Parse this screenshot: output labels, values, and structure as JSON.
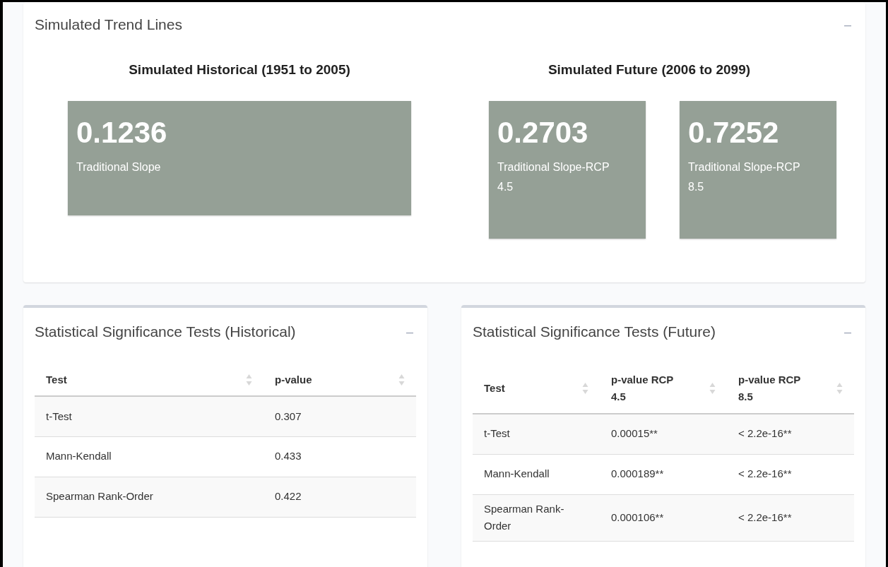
{
  "trend_card": {
    "title": "Simulated Trend Lines",
    "collapse_icon": "–",
    "groups": [
      {
        "heading": "Simulated Historical (1951 to 2005)",
        "boxes": [
          {
            "value": "0.1236",
            "label": "Traditional Slope"
          }
        ]
      },
      {
        "heading": "Simulated Future (2006 to 2099)",
        "boxes": [
          {
            "value": "0.2703",
            "label": "Traditional Slope-RCP 4.5"
          },
          {
            "value": "0.7252",
            "label": "Traditional Slope-RCP 8.5"
          }
        ]
      }
    ]
  },
  "tables": [
    {
      "title": "Statistical Significance Tests (Historical)",
      "collapse_icon": "–",
      "columns": [
        "Test",
        "p-value"
      ],
      "rows": [
        [
          "t-Test",
          "0.307"
        ],
        [
          "Mann-Kendall",
          "0.433"
        ],
        [
          "Spearman Rank-Order",
          "0.422"
        ]
      ]
    },
    {
      "title": "Statistical Significance Tests (Future)",
      "collapse_icon": "–",
      "columns": [
        "Test",
        "p-value RCP 4.5",
        "p-value RCP 8.5"
      ],
      "rows": [
        [
          "t-Test",
          "0.00015**",
          "< 2.2e-16**"
        ],
        [
          "Mann-Kendall",
          "0.000189**",
          "< 2.2e-16**"
        ],
        [
          "Spearman Rank-Order",
          "0.000106**",
          "< 2.2e-16**"
        ]
      ]
    }
  ]
}
